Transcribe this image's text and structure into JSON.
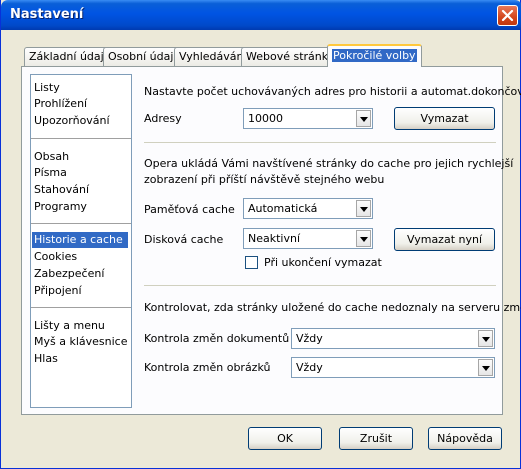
{
  "window": {
    "title": "Nastavení"
  },
  "tabs": [
    {
      "label": "Základní údaje"
    },
    {
      "label": "Osobní údaje"
    },
    {
      "label": "Vyhledávání"
    },
    {
      "label": "Webové stránky"
    },
    {
      "label": "Pokročilé volby",
      "active": true
    }
  ],
  "sidebar": {
    "groups": [
      [
        "Listy",
        "Prohlížení",
        "Upozorňování"
      ],
      [
        "Obsah",
        "Písma",
        "Stahování",
        "Programy"
      ],
      [
        "Historie a cache",
        "Cookies",
        "Zabezpečení",
        "Připojení"
      ],
      [
        "Lišty a menu",
        "Myš a klávesnice",
        "Hlas"
      ]
    ],
    "selected": "Historie a cache"
  },
  "history": {
    "heading": "Nastavte počet uchovávaných adres pro historii a automat.dokončování",
    "addresses_label": "Adresy",
    "addresses_value": "10000",
    "clear_button": "Vymazat"
  },
  "cache": {
    "description_line1": "Opera ukládá Vámi navštívené stránky do cache pro jejich rychlejší",
    "description_line2": "zobrazení při příští návštěvě stejného webu",
    "memory_label": "Paměťová cache",
    "memory_value": "Automatická",
    "disk_label": "Disková cache",
    "disk_value": "Neaktivní",
    "clear_now_button": "Vymazat nyní",
    "clear_on_exit_label": "Při ukončení vymazat",
    "clear_on_exit_checked": false
  },
  "check": {
    "heading": "Kontrolovat, zda stránky uložené do cache nedoznaly na serveru změn",
    "documents_label": "Kontrola změn dokumentů",
    "documents_value": "Vždy",
    "images_label": "Kontrola změn obrázků",
    "images_value": "Vždy"
  },
  "footer": {
    "ok": "OK",
    "cancel": "Zrušit",
    "help": "Nápověda"
  },
  "colors": {
    "titlebar": "#0054e3",
    "selection": "#316ac5",
    "window_bg": "#ece9d8"
  }
}
